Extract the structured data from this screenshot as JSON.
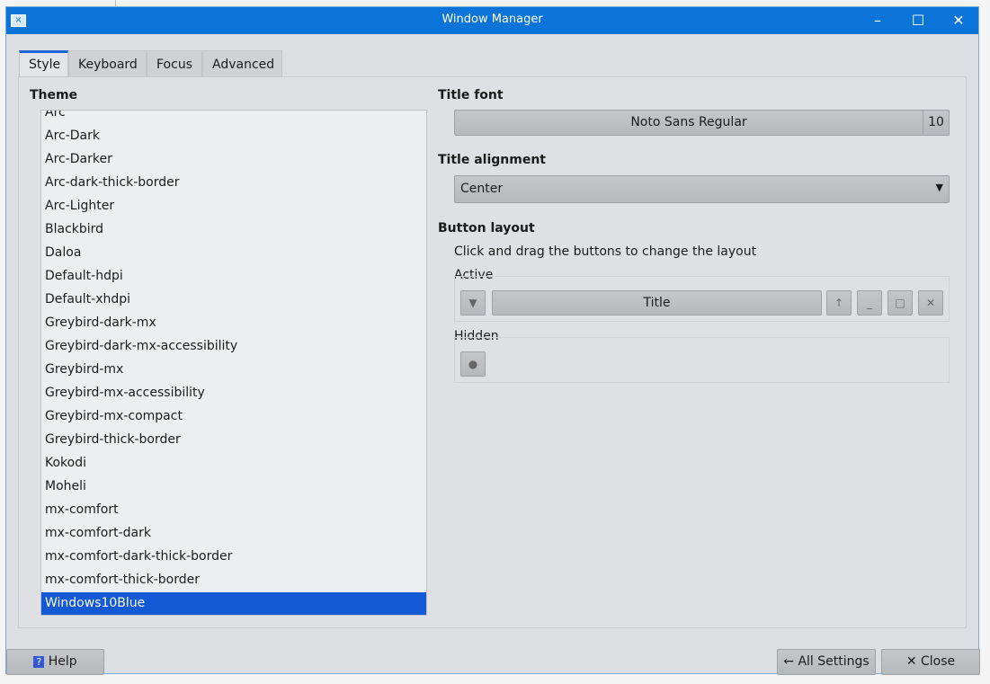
{
  "window": {
    "title": "Window Manager"
  },
  "tabs": [
    {
      "label": "Style"
    },
    {
      "label": "Keyboard"
    },
    {
      "label": "Focus"
    },
    {
      "label": "Advanced"
    }
  ],
  "theme": {
    "label": "Theme",
    "items": [
      "Arc",
      "Arc-Dark",
      "Arc-Darker",
      "Arc-dark-thick-border",
      "Arc-Lighter",
      "Blackbird",
      "Daloa",
      "Default-hdpi",
      "Default-xhdpi",
      "Greybird-dark-mx",
      "Greybird-dark-mx-accessibility",
      "Greybird-mx",
      "Greybird-mx-accessibility",
      "Greybird-mx-compact",
      "Greybird-thick-border",
      "Kokodi",
      "Moheli",
      "mx-comfort",
      "mx-comfort-dark",
      "mx-comfort-dark-thick-border",
      "mx-comfort-thick-border",
      "Windows10Blue"
    ],
    "selected": "Windows10Blue"
  },
  "title_font": {
    "label": "Title font",
    "name": "Noto Sans Regular",
    "size": "10"
  },
  "title_alignment": {
    "label": "Title alignment",
    "value": "Center"
  },
  "button_layout": {
    "label": "Button layout",
    "hint": "Click and drag the buttons to change the layout",
    "active_label": "Active",
    "title_button": "Title",
    "hidden_label": "Hidden"
  },
  "footer": {
    "help": "Help",
    "all_settings": "All Settings",
    "close": "Close"
  },
  "colors": {
    "titlebar": "#0b74d8",
    "selection": "#1259d6"
  }
}
